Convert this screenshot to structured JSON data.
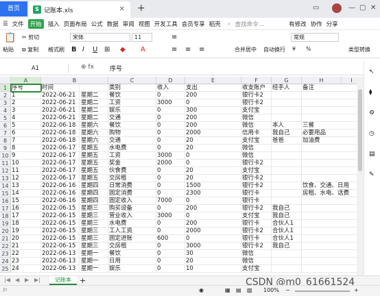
{
  "tabs": {
    "home": "首页",
    "file": "记账本.xls"
  },
  "menu": {
    "items": [
      "文件",
      "开始",
      "插入",
      "页面布局",
      "公式",
      "数据",
      "审阅",
      "视图",
      "开发工具",
      "会员专享",
      "稻壳"
    ],
    "search": "查找命令…",
    "right": [
      "有修改",
      "协作",
      "分享"
    ]
  },
  "toolbar": {
    "paste": "粘贴",
    "cut": "剪切",
    "copy": "复制",
    "format_painter": "格式刷",
    "font": "宋体",
    "size": "11",
    "merge": "合并居中",
    "wrap": "自动换行",
    "numfmt": "常规",
    "cond": "类型转换",
    "bold": "B",
    "italic": "I",
    "underline": "U"
  },
  "formula": {
    "cell_ref": "A1",
    "fx": "fx",
    "value": "序号"
  },
  "columns": [
    "A",
    "B",
    "C",
    "D",
    "E",
    "F",
    "G",
    "H",
    "I"
  ],
  "rows": [
    [
      "序号",
      "时间",
      "",
      "类别",
      "收入",
      "支出",
      "收支账户",
      "经手人",
      "备注"
    ],
    [
      "1",
      "2022-06-21",
      "星期二",
      "餐饮",
      "0",
      "200",
      "银行卡2",
      "",
      ""
    ],
    [
      "2",
      "2022-06-21",
      "星期二",
      "工资",
      "3000",
      "0",
      "银行卡2",
      "",
      ""
    ],
    [
      "3",
      "2022-06-21",
      "星期二",
      "娱乐",
      "0",
      "300",
      "支付宝",
      "",
      ""
    ],
    [
      "4",
      "2022-06-21",
      "星期二",
      "交通",
      "0",
      "200",
      "微信",
      "",
      ""
    ],
    [
      "5",
      "2022-06-18",
      "星期六",
      "餐饮",
      "0",
      "200",
      "微信",
      "本人",
      "三餐"
    ],
    [
      "6",
      "2022-06-18",
      "星期六",
      "购物",
      "0",
      "2000",
      "信用卡",
      "我自己",
      "必要用品"
    ],
    [
      "7",
      "2022-06-18",
      "星期六",
      "交通",
      "0",
      "20",
      "支付宝",
      "爸爸",
      "加油费"
    ],
    [
      "8",
      "2022-06-17",
      "星期五",
      "水电费",
      "0",
      "20",
      "微信",
      "",
      ""
    ],
    [
      "9",
      "2022-06-17",
      "星期五",
      "工资",
      "3000",
      "0",
      "微信",
      "",
      ""
    ],
    [
      "10",
      "2022-06-17",
      "星期五",
      "奖金",
      "2000",
      "0",
      "银行卡2",
      "",
      ""
    ],
    [
      "11",
      "2022-06-17",
      "星期五",
      "伙食费",
      "0",
      "20",
      "支付宝",
      "",
      ""
    ],
    [
      "12",
      "2022-06-17",
      "星期五",
      "交房租",
      "0",
      "20",
      "银行卡2",
      "",
      ""
    ],
    [
      "13",
      "2022-06-16",
      "星期四",
      "日常消费",
      "0",
      "1500",
      "银行卡2",
      "",
      "饮食、交通、日用"
    ],
    [
      "14",
      "2022-06-16",
      "星期四",
      "固定消费",
      "0",
      "2300",
      "银行卡",
      "",
      "房租、水电、话费"
    ],
    [
      "15",
      "2022-06-16",
      "星期四",
      "固定收入",
      "7000",
      "0",
      "银行卡",
      "",
      ""
    ],
    [
      "16",
      "2022-06-15",
      "星期三",
      "购买设备",
      "0",
      "200",
      "银行卡2",
      "我自己",
      ""
    ],
    [
      "17",
      "2022-06-15",
      "星期三",
      "营业收入",
      "3000",
      "0",
      "支付宝",
      "我自己",
      ""
    ],
    [
      "18",
      "2022-06-15",
      "星期三",
      "水电费",
      "0",
      "200",
      "银行卡",
      "合伙人1",
      ""
    ],
    [
      "19",
      "2022-06-15",
      "星期三",
      "工人工资",
      "0",
      "2000",
      "银行卡2",
      "合伙人1",
      ""
    ],
    [
      "20",
      "2022-06-15",
      "星期三",
      "固定进账",
      "600",
      "0",
      "银行卡",
      "合伙人1",
      ""
    ],
    [
      "21",
      "2022-06-15",
      "星期三",
      "交房租",
      "0",
      "3000",
      "银行卡2",
      "我自己",
      ""
    ],
    [
      "22",
      "2022-06-13",
      "星期一",
      "餐饮",
      "0",
      "30",
      "微信",
      "",
      ""
    ],
    [
      "23",
      "2022-06-13",
      "星期一",
      "日用",
      "0",
      "20",
      "微信",
      "",
      ""
    ],
    [
      "24",
      "2022-06-13",
      "星期一",
      "娱乐",
      "0",
      "10",
      "支付宝",
      "",
      ""
    ]
  ],
  "sheet": {
    "name": "记账本"
  },
  "status": {
    "zoom": "100%"
  },
  "watermark": "CSDN @m0_61661524"
}
